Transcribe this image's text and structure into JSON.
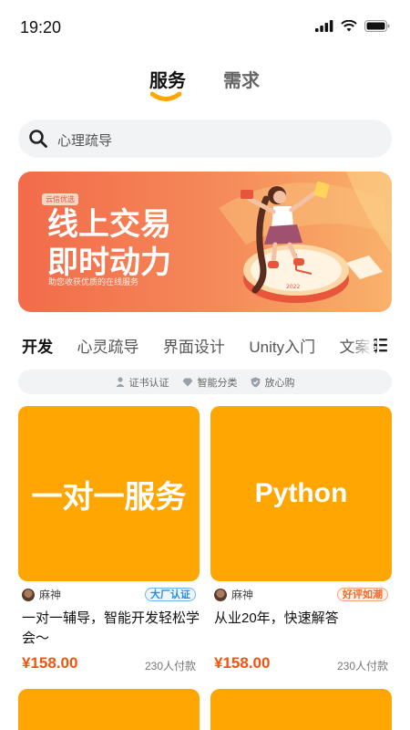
{
  "status": {
    "time": "19:20"
  },
  "top_tabs": [
    {
      "label": "服务",
      "active": true
    },
    {
      "label": "需求",
      "active": false
    }
  ],
  "search": {
    "placeholder": "心理疏导"
  },
  "banner": {
    "badge": "云信优选",
    "title_line1": "线上交易",
    "title_line2": "即时动力",
    "subtitle": "助您收获优质的在线服务",
    "year_text": "2022"
  },
  "categories": [
    {
      "label": "开发",
      "active": true
    },
    {
      "label": "心灵疏导",
      "active": false
    },
    {
      "label": "界面设计",
      "active": false
    },
    {
      "label": "Unity入门",
      "active": false
    },
    {
      "label": "文案编辑",
      "active": false
    }
  ],
  "features": [
    {
      "icon": "person-icon",
      "label": "证书认证"
    },
    {
      "icon": "diamond-icon",
      "label": "智能分类"
    },
    {
      "icon": "shield-icon",
      "label": "放心购"
    }
  ],
  "cards": [
    {
      "image_text": "一对一服务",
      "author": "麻神",
      "badge": "大厂认证",
      "title": "一对一辅导，智能开发轻松学会～",
      "price": "¥158.00",
      "sales": "230人付款"
    },
    {
      "image_text": "Python",
      "author": "麻神",
      "badge": "好评如潮",
      "title": "从业20年，快速解答",
      "price": "¥158.00",
      "sales": "230人付款"
    }
  ],
  "colors": {
    "card_image_bg": "#ffa602",
    "price": "#f2540f",
    "tab_indicator": "#ffa602",
    "banner_gradient_start": "#f26b4a",
    "banner_gradient_end": "#f9b26b"
  }
}
